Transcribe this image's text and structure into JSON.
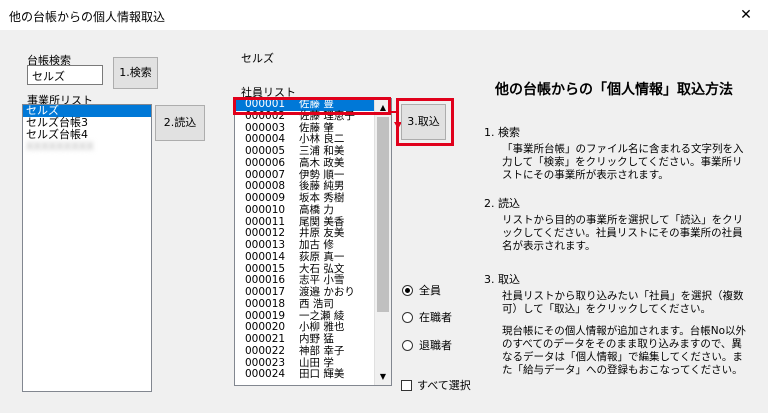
{
  "window": {
    "title": "他の台帳からの個人情報取込",
    "close": "✕"
  },
  "search": {
    "label": "台帳検索",
    "value": "セルズ",
    "button": "1.検索"
  },
  "offices": {
    "label": "事業所リスト",
    "items": [
      "セルズ",
      "セルズ台帳3",
      "セルズ台帳4"
    ],
    "blurred": "XXXXXXXXX",
    "read_button": "2.読込"
  },
  "selected_office": "セルズ",
  "employees": {
    "label": "社員リスト",
    "rows": [
      [
        "000001",
        "佐藤 豊"
      ],
      [
        "000002",
        "佐藤 理恵子"
      ],
      [
        "000003",
        "佐藤 肇"
      ],
      [
        "000004",
        "小林 良二"
      ],
      [
        "000005",
        "三浦 和美"
      ],
      [
        "000006",
        "高木 政美"
      ],
      [
        "000007",
        "伊勢 順一"
      ],
      [
        "000008",
        "後藤 純男"
      ],
      [
        "000009",
        "坂本 秀樹"
      ],
      [
        "000010",
        "高橋 力"
      ],
      [
        "000011",
        "尾関 美香"
      ],
      [
        "000012",
        "井原 友美"
      ],
      [
        "000013",
        "加古 修"
      ],
      [
        "000014",
        "荻原 真一"
      ],
      [
        "000015",
        "大石 弘文"
      ],
      [
        "000016",
        "志平 小雪"
      ],
      [
        "000017",
        "渡邉 かおり"
      ],
      [
        "000018",
        "西 浩司"
      ],
      [
        "000019",
        "一之瀬 綾"
      ],
      [
        "000020",
        "小柳 雅也"
      ],
      [
        "000021",
        "内野 猛"
      ],
      [
        "000022",
        "神部 幸子"
      ],
      [
        "000023",
        "山田 学"
      ],
      [
        "000024",
        "田口 輝美"
      ]
    ]
  },
  "import_button": "3.取込",
  "radios": [
    "全員",
    "在職者",
    "退職者"
  ],
  "select_all": "すべて選択",
  "help": {
    "heading": "他の台帳からの「個人情報」取込方法",
    "s1_title": "1. 検索",
    "s1_body": "「事業所台帳」のファイル名に含まれる文字列を入力して「検索」をクリックしてください。事業所リストにその事業所が表示されます。",
    "s2_title": "2. 読込",
    "s2_body": "リストから目的の事業所を選択して「読込」をクリックしてください。社員リストにその事業所の社員名が表示されます。",
    "s3_title": "3. 取込",
    "s3_body1": "社員リストから取り込みたい「社員」を選択（複数可）して「取込」をクリックしてください。",
    "s3_body2": "現台帳にその個人情報が追加されます。台帳No以外のすべてのデータをそのまま取り込みますので、異なるデータは「個人情報」で編集してください。また「給与データ」への登録もおこなってください。"
  },
  "colors": {
    "selection": "#0078d7",
    "highlight_box": "#e0001b"
  }
}
